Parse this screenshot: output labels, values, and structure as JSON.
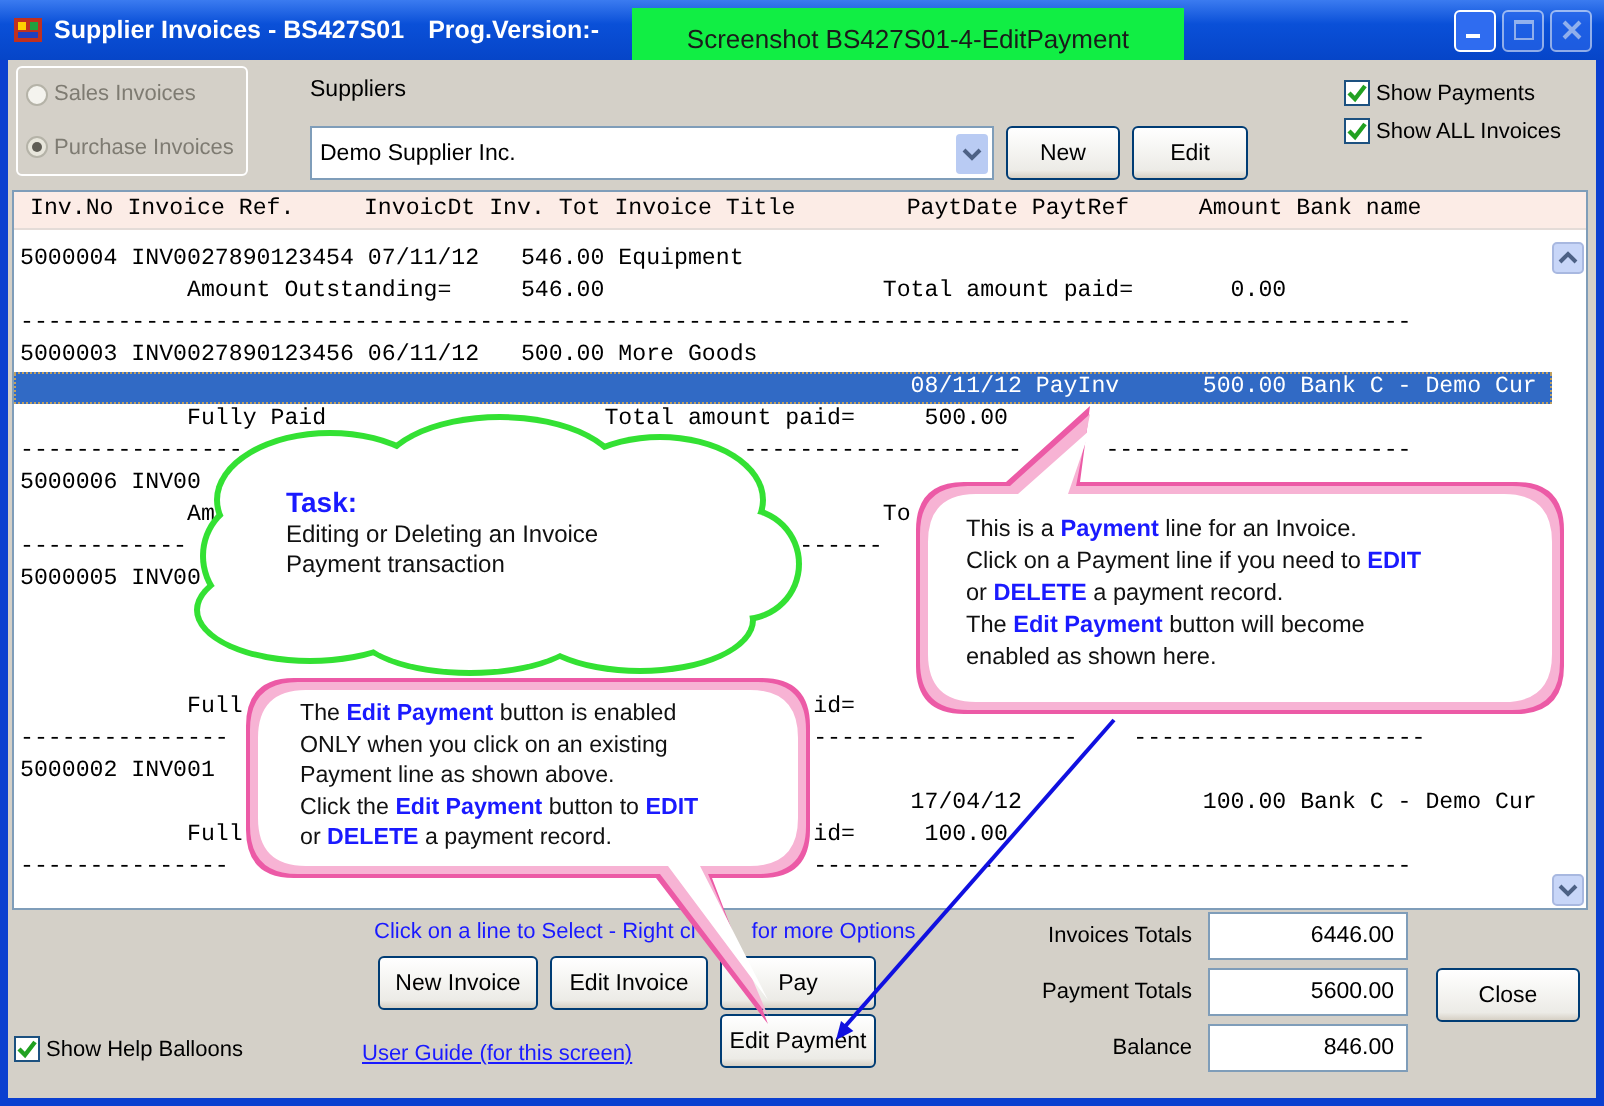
{
  "window": {
    "title": "Supplier Invoices - BS427S01",
    "version_label": "Prog.Version:-"
  },
  "screenshot_label": "Screenshot BS427S01-4-EditPayment",
  "invoice_type": {
    "disabled": true,
    "options": [
      {
        "label": "Sales Invoices",
        "selected": false
      },
      {
        "label": "Purchase Invoices",
        "selected": true
      }
    ]
  },
  "suppliers": {
    "label": "Suppliers",
    "value": "Demo Supplier Inc."
  },
  "supplier_buttons": [
    "New",
    "Edit"
  ],
  "options": [
    {
      "label": "Show Payments",
      "checked": true
    },
    {
      "label": "Show ALL Invoices",
      "checked": true
    }
  ],
  "list": {
    "header": "Inv.No Invoice Ref.     InvoicDt Inv. Tot Invoice Title        PaytDate PaytRef     Amount Bank name",
    "rows": [
      {
        "parts": [
          "5000004 INV0027890123454 07/11/12   546.00 Equipment"
        ],
        "selected": false
      },
      {
        "parts": [
          "            Amount Outstanding=     546.00                    Total amount paid=       0.00"
        ],
        "selected": false
      },
      {
        "parts": [
          "----------------------------------------------------------------------------------------------------"
        ],
        "selected": false
      },
      {
        "parts": [
          "5000003 INV0027890123456 06/11/12   500.00 More Goods"
        ],
        "selected": false
      },
      {
        "parts": [
          "                                                                08/11/12 PayInv      500.00 Bank C - Demo Cur"
        ],
        "selected": true
      },
      {
        "parts": [
          "            Fully Paid                    Total amount paid=     500.00"
        ],
        "selected": false
      },
      {
        "parts": [
          "----------------",
          "                                    --------------------",
          "      ----------------------"
        ],
        "selected": false
      },
      {
        "parts": [
          "5000006 INV00"
        ],
        "selected": false
      },
      {
        "parts": [
          "            Am",
          "                                                To"
        ],
        "selected": false
      },
      {
        "parts": [
          "------------",
          "                                            ------"
        ],
        "selected": false
      },
      {
        "parts": [
          "5000005 INV00"
        ],
        "selected": false
      },
      {
        "selected": false
      },
      {
        "selected": false
      },
      {
        "selected": false
      },
      {
        "parts": [
          "            Full",
          "                                         id="
        ],
        "selected": false
      },
      {
        "parts": [
          "---------------",
          "                                          -------------------",
          "    ---------------------"
        ],
        "selected": false
      },
      {
        "parts": [
          "5000002 INV001"
        ],
        "selected": false
      },
      {
        "parts": [
          "                                                                17/04/12             100.00 Bank C - Demo Cur"
        ],
        "selected": false
      },
      {
        "parts": [
          "            Full",
          "                                         id=     100.00"
        ],
        "selected": false
      },
      {
        "parts": [
          "---------------",
          "                                          -------------------------------------------"
        ],
        "selected": false
      }
    ]
  },
  "hint": [
    "Click on a line to Select - Right cl",
    "for more Options"
  ],
  "action_buttons": [
    "New Invoice",
    "Edit Invoice",
    "Pay",
    "Edit Payment"
  ],
  "help_balloons": {
    "label": "Show Help Balloons",
    "checked": true
  },
  "user_guide_link": "User Guide (for this screen)",
  "totals": [
    {
      "label": "Invoices Totals",
      "value": "6446.00"
    },
    {
      "label": "Payment Totals",
      "value": "5600.00"
    },
    {
      "label": "Balance",
      "value": "846.00"
    }
  ],
  "close_button": "Close",
  "callouts": [
    {
      "kind": "cloud",
      "title": "Task:",
      "lines": [
        "Editing or Deleting an Invoice",
        "Payment transaction"
      ]
    },
    {
      "kind": "balloon",
      "lines": [
        "This is a **Payment** line for an Invoice.",
        "Click on a Payment line if you need to **EDIT**",
        "or **DELETE** a payment record.",
        "The **Edit Payment** button will become",
        "enabled as shown here."
      ]
    },
    {
      "kind": "balloon",
      "lines": [
        "The **Edit Payment** button is enabled",
        "ONLY when you click on an existing",
        "Payment line as shown above.",
        "Click the **Edit Payment** button to **EDIT**",
        "or **DELETE** a payment record."
      ]
    }
  ]
}
